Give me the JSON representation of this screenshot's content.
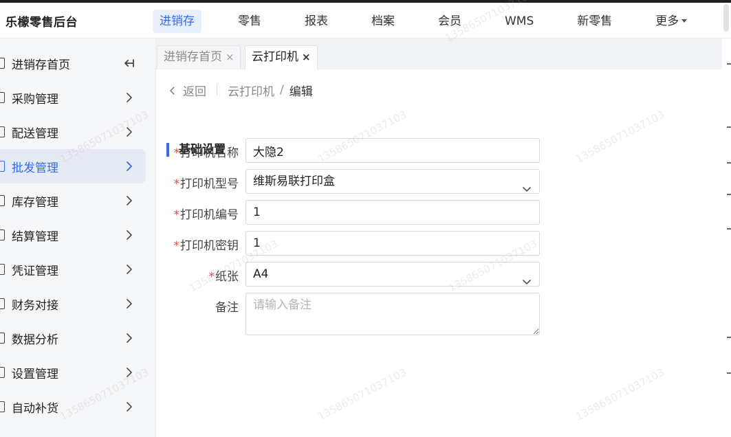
{
  "brand": "乐檬零售后台",
  "top_nav": {
    "items": [
      {
        "label": "进销存",
        "active": true
      },
      {
        "label": "零售",
        "active": false
      },
      {
        "label": "报表",
        "active": false
      },
      {
        "label": "档案",
        "active": false
      },
      {
        "label": "会员",
        "active": false
      },
      {
        "label": "WMS",
        "active": false
      },
      {
        "label": "新零售",
        "active": false
      },
      {
        "label": "更多",
        "active": false,
        "dropdown": true
      }
    ]
  },
  "sidebar": {
    "items": [
      {
        "label": "进销存首页",
        "icon": "collapse-left-icon"
      },
      {
        "label": "采购管理",
        "icon": "chevron-right-icon"
      },
      {
        "label": "配送管理",
        "icon": "chevron-right-icon"
      },
      {
        "label": "批发管理",
        "icon": "chevron-right-icon",
        "active": true
      },
      {
        "label": "库存管理",
        "icon": "chevron-right-icon"
      },
      {
        "label": "结算管理",
        "icon": "chevron-right-icon"
      },
      {
        "label": "凭证管理",
        "icon": "chevron-right-icon"
      },
      {
        "label": "财务对接",
        "icon": "chevron-right-icon"
      },
      {
        "label": "数据分析",
        "icon": "chevron-right-icon"
      },
      {
        "label": "设置管理",
        "icon": "chevron-right-icon"
      },
      {
        "label": "自动补货",
        "icon": "chevron-right-icon"
      }
    ]
  },
  "tabs": [
    {
      "label": "进销存首页",
      "active": false,
      "close": "×"
    },
    {
      "label": "云打印机",
      "active": true,
      "close": "×"
    }
  ],
  "breadcrumb": {
    "back": "返回",
    "parent": "云打印机",
    "separator": "/",
    "current": "编辑"
  },
  "section_title": "基础设置",
  "form": {
    "required_mark": "*",
    "printer_name": {
      "label": "打印机名称",
      "value": "大隐2"
    },
    "printer_model": {
      "label": "打印机型号",
      "value": "维斯易联打印盒"
    },
    "printer_number": {
      "label": "打印机编号",
      "value": "1"
    },
    "printer_key": {
      "label": "打印机密钥",
      "value": "1"
    },
    "paper": {
      "label": "纸张",
      "value": "A4"
    },
    "remark": {
      "label": "备注",
      "placeholder": "请输入备注"
    }
  },
  "watermark_text": "13586507103710​3",
  "colors": {
    "accent": "#2f6bff",
    "required": "#e64545",
    "active_nav_bg": "#e8efff"
  }
}
